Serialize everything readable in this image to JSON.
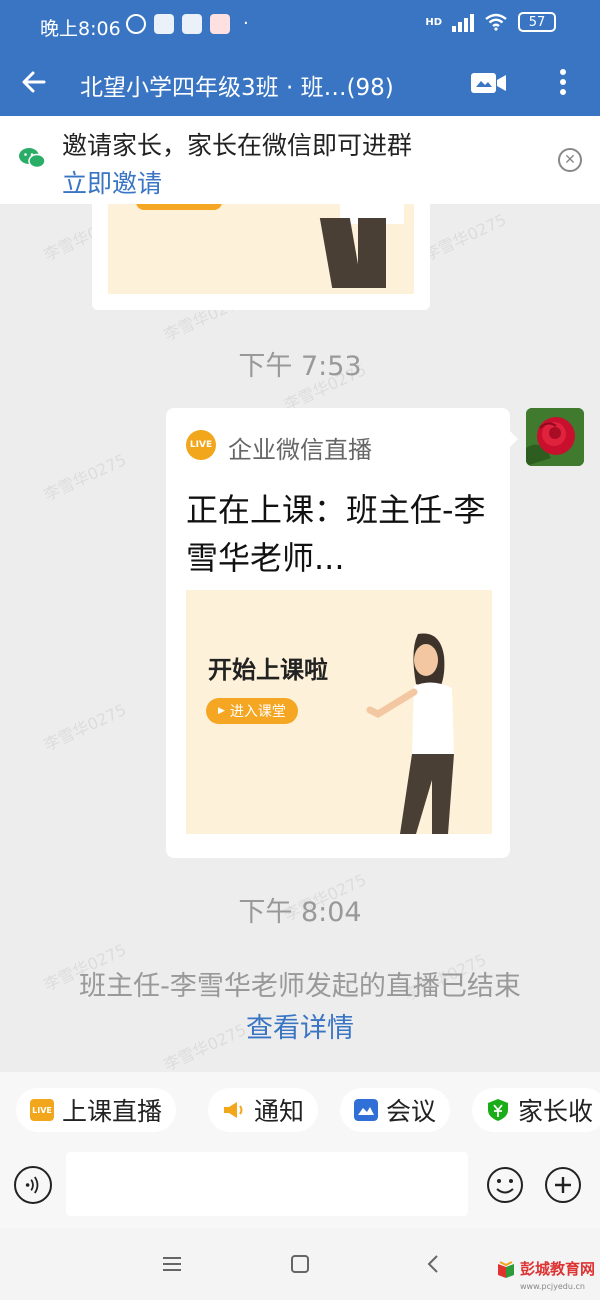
{
  "status_bar": {
    "time": "晚上8:06",
    "dot": "·",
    "network": "HD",
    "battery": "57"
  },
  "header": {
    "title": "北望小学四年级3班 · 班…(98)",
    "icons": [
      "back-arrow-icon",
      "video-call-icon",
      "more-icon"
    ]
  },
  "invite_banner": {
    "text": "邀请家长，家长在微信即可进群",
    "link": "立即邀请",
    "icons": [
      "wechat-icon",
      "close-icon"
    ]
  },
  "watermark": "李雪华0275",
  "messages": {
    "timestamp_1": "下午 7:53",
    "live_card": {
      "badge": "LIVE",
      "source": "企业微信直播",
      "title": "正在上课：班主任-李雪华老师...",
      "cover_text": "开始上课啦",
      "cover_button": "进入课堂"
    },
    "timestamp_2": "下午 8:04",
    "system_text": "班主任-李雪华老师发起的直播已结束",
    "system_link": "查看详情"
  },
  "quick_actions": [
    {
      "label": "上课直播",
      "icon": "live-icon",
      "badge": "LIVE"
    },
    {
      "label": "通知",
      "icon": "megaphone-icon"
    },
    {
      "label": "会议",
      "icon": "meeting-icon"
    },
    {
      "label": "家长收",
      "icon": "payment-icon"
    }
  ],
  "input": {
    "placeholder": "",
    "icons": [
      "voice-icon",
      "emoji-icon",
      "plus-icon"
    ]
  },
  "nav": {
    "icons": [
      "menu-icon",
      "home-icon",
      "back-icon"
    ]
  },
  "brand": {
    "name": "彭城教育网",
    "url": "www.pcjyedu.cn"
  },
  "colors": {
    "primary": "#3a75c4",
    "chat_bg": "#ededed",
    "live_orange": "#f2a61c",
    "meeting_blue": "#2f6fd6",
    "payment_green": "#1aad19"
  }
}
